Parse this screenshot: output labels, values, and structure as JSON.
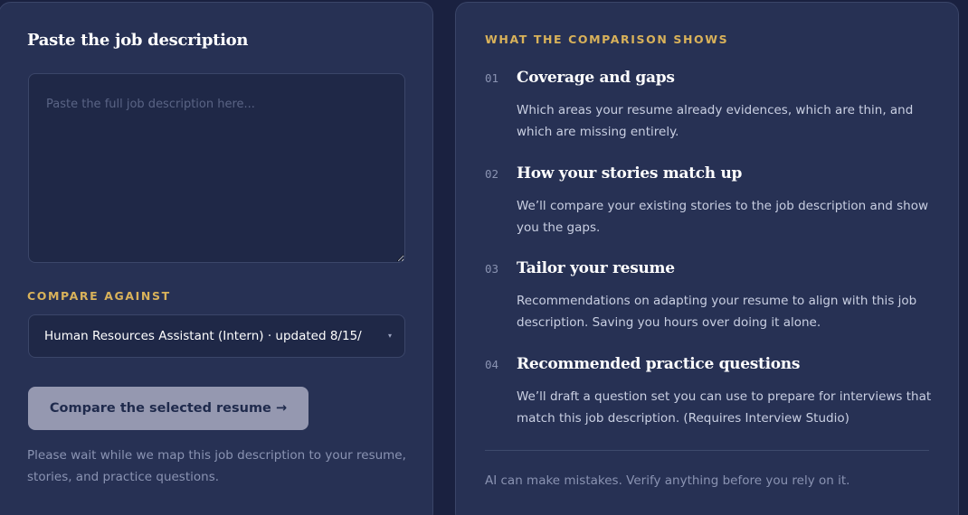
{
  "left": {
    "title": "Paste the job description",
    "textarea_placeholder": "Paste the full job description here...",
    "compare_label": "COMPARE AGAINST",
    "select_value": "Human Resources Assistant (Intern) · updated 8/15/",
    "compare_button": "Compare the selected resume →",
    "wait_note": "Please wait while we map this job description to your resume, stories, and practice questions."
  },
  "right": {
    "section_label": "WHAT THE COMPARISON SHOWS",
    "features": [
      {
        "num": "01",
        "title": "Coverage and gaps",
        "desc": "Which areas your resume already evidences, which are thin, and which are missing entirely."
      },
      {
        "num": "02",
        "title": "How your stories match up",
        "desc": "We’ll compare your existing stories to the job description and show you the gaps."
      },
      {
        "num": "03",
        "title": "Tailor your resume",
        "desc": "Recommendations on adapting your resume to align with this job description. Saving you hours over doing it alone."
      },
      {
        "num": "04",
        "title": "Recommended practice questions",
        "desc": "We’ll draft a question set you can use to prepare for interviews that match this job description. (Requires Interview Studio)"
      }
    ],
    "ai_note": "AI can make mistakes. Verify anything before you rely on it."
  },
  "icons": {
    "select_caret": "chevron-down-icon"
  },
  "colors": {
    "background": "#1a2140",
    "card": "#273154",
    "accent_gold": "#d9b25a",
    "button": "#9598b0"
  }
}
